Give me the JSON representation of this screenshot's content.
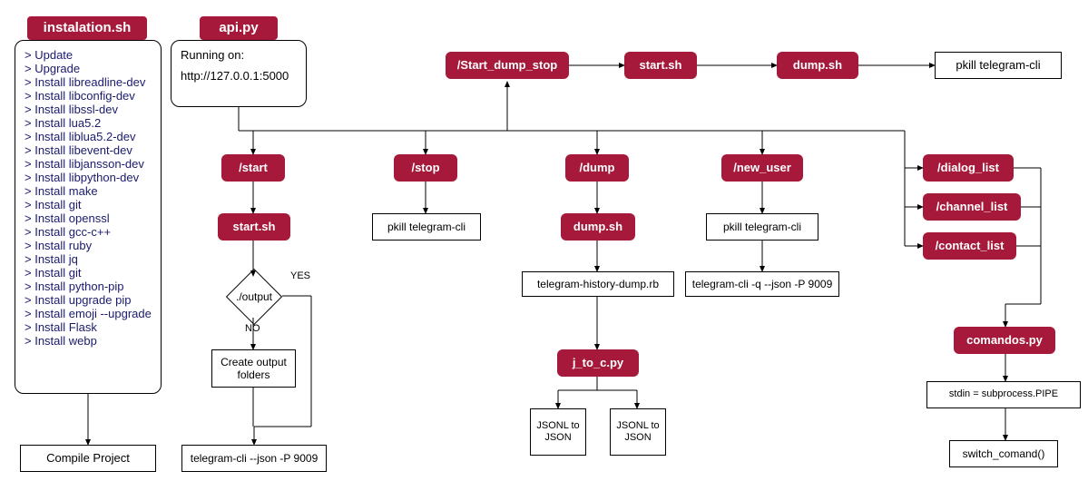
{
  "installation": {
    "title": "instalation.sh",
    "items": [
      "Update",
      "Upgrade",
      "Install libreadline-dev",
      "Install libconfig-dev",
      "Install libssl-dev",
      "Install lua5.2",
      "Install liblua5.2-dev",
      "Install libevent-dev",
      "Install libjansson-dev",
      "Install libpython-dev",
      "Install make",
      "Install  git",
      "Install openssl",
      "Install gcc-c++",
      "Install ruby",
      "Install jq",
      "Install git",
      "Install python-pip",
      "Install upgrade pip",
      "Install emoji --upgrade",
      "Install Flask",
      "Install webp"
    ]
  },
  "compile": "Compile Project",
  "api": {
    "title": "api.py",
    "running_label": "Running on:",
    "url": "http://127.0.0.1:5000"
  },
  "top_row": {
    "start_dump_stop": "/Start_dump_stop",
    "start_sh": "start.sh",
    "dump_sh": "dump.sh",
    "pkill": "pkill telegram-cli"
  },
  "start_col": {
    "start": "/start",
    "start_sh": "start.sh",
    "output_decision": "./output",
    "yes": "YES",
    "no": "NO",
    "create_folders": "Create output folders",
    "tcli": "telegram-cli --json -P 9009"
  },
  "stop_col": {
    "stop": "/stop",
    "pkill": "pkill telegram-cli"
  },
  "dump_col": {
    "dump": "/dump",
    "dump_sh": "dump.sh",
    "rb": "telegram-history-dump.rb",
    "j2c": "j_to_c.py",
    "jsonl1": "JSONL to JSON",
    "jsonl2": "JSONL to JSON"
  },
  "newuser_col": {
    "newuser": "/new_user",
    "pkill": "pkill telegram-cli",
    "tcli": "telegram-cli -q --json -P 9009"
  },
  "right_col": {
    "dialog": "/dialog_list",
    "channel": "/channel_list",
    "contact": "/contact_list",
    "comandos": "comandos.py",
    "stdin": "stdin = subprocess.PIPE",
    "switch": "switch_comand()"
  }
}
